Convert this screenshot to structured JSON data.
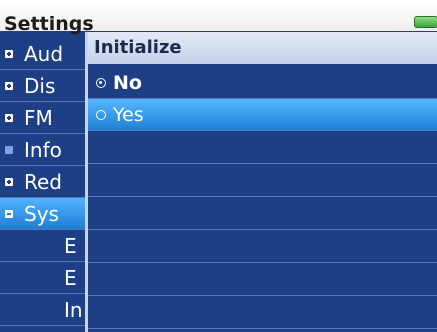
{
  "header": {
    "title": "Settings"
  },
  "menu": {
    "items": [
      {
        "label": "Aud",
        "icon": "expand-icon"
      },
      {
        "label": "Dis",
        "icon": "expand-icon"
      },
      {
        "label": "FM",
        "icon": "expand-icon"
      },
      {
        "label": "Info",
        "icon": "info-icon"
      },
      {
        "label": "Red",
        "icon": "expand-icon"
      },
      {
        "label": "Sys",
        "icon": "collapse-icon"
      },
      {
        "label": "E"
      },
      {
        "label": "E"
      },
      {
        "label": "In"
      }
    ]
  },
  "popup": {
    "title": "Initialize",
    "options": [
      {
        "label": "No",
        "checked": true
      },
      {
        "label": "Yes",
        "checked": false
      }
    ]
  }
}
